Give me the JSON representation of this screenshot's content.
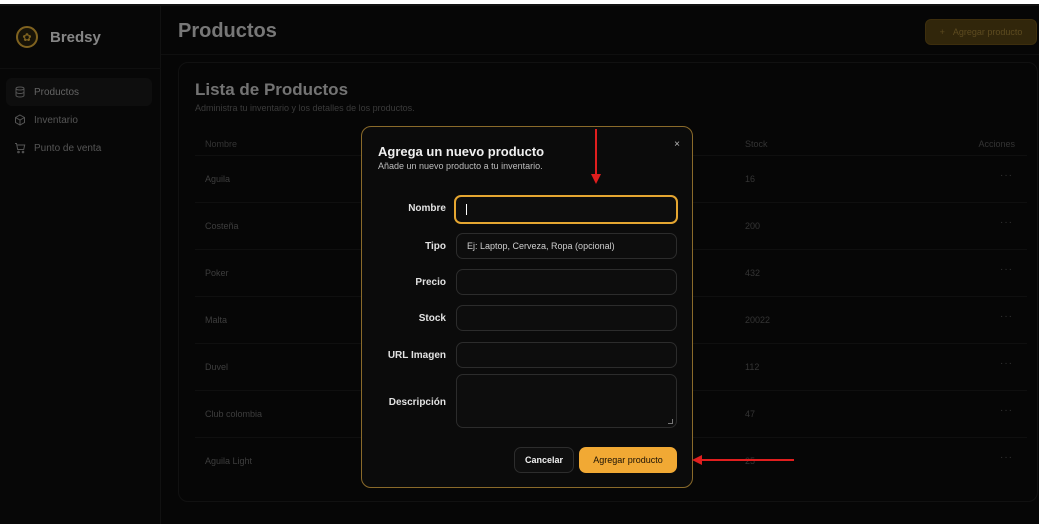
{
  "brand": {
    "name": "Bredsy"
  },
  "sidebar": {
    "items": [
      {
        "label": "Productos",
        "icon": "database-icon",
        "active": true
      },
      {
        "label": "Inventario",
        "icon": "package-icon",
        "active": false
      },
      {
        "label": "Punto de venta",
        "icon": "cart-icon",
        "active": false
      }
    ]
  },
  "header": {
    "title": "Productos",
    "add_button": "Agregar producto"
  },
  "card": {
    "title": "Lista de Productos",
    "subtitle": "Administra tu inventario y los detalles de los productos.",
    "columns": {
      "name": "Nombre",
      "stock": "Stock",
      "actions": "Acciones"
    },
    "rows": [
      {
        "name": "Aguila",
        "stock": "16"
      },
      {
        "name": "Costeña",
        "stock": "200"
      },
      {
        "name": "Poker",
        "stock": "432"
      },
      {
        "name": "Malta",
        "stock": "20022"
      },
      {
        "name": "Duvel",
        "stock": "112"
      },
      {
        "name": "Club colombia",
        "stock": "47"
      },
      {
        "name": "Aguila Light",
        "stock": "25"
      }
    ],
    "actions_glyph": "···"
  },
  "modal": {
    "title": "Agrega un nuevo producto",
    "subtitle": "Añade un nuevo producto a tu inventario.",
    "close": "×",
    "fields": {
      "nombre": {
        "label": "Nombre",
        "value": ""
      },
      "tipo": {
        "label": "Tipo",
        "placeholder": "Ej: Laptop, Cerveza, Ropa (opcional)"
      },
      "precio": {
        "label": "Precio",
        "value": ""
      },
      "stock": {
        "label": "Stock",
        "value": ""
      },
      "url": {
        "label": "URL Imagen",
        "value": ""
      },
      "descripcion": {
        "label": "Descripción",
        "value": ""
      }
    },
    "cancel": "Cancelar",
    "submit": "Agregar producto"
  },
  "colors": {
    "accent": "#f1a934",
    "annotation": "#e01e1e",
    "background": "#0b0b0b"
  }
}
